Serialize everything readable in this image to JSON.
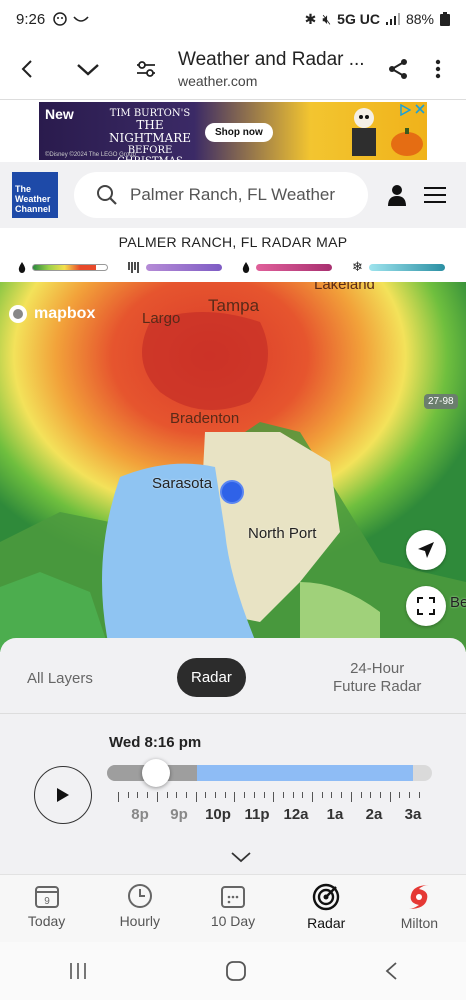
{
  "status_bar": {
    "time": "9:26",
    "network": "5G UC",
    "battery": "88%"
  },
  "browser": {
    "title": "Weather and Radar ...",
    "url": "weather.com"
  },
  "ad": {
    "badge": "New",
    "headline_line1": "TIM BURTON'S",
    "headline_line2": "THE NIGHTMARE",
    "headline_line3": "BEFORE CHRISTMAS",
    "button": "Shop now",
    "copyright": "©Disney  ©2024 The LEGO Group"
  },
  "site": {
    "logo_line1": "The",
    "logo_line2": "Weather",
    "logo_line3": "Channel",
    "search_placeholder": "Palmer Ranch, FL Weather"
  },
  "radar": {
    "title": "PALMER RANCH, FL RADAR MAP",
    "legend": [
      {
        "icon": "rain-drop-icon",
        "colors": [
          "#2b8a3e",
          "#9bd14a",
          "#f4e04d",
          "#e8492a",
          "#ffffff"
        ]
      },
      {
        "icon": "sleet-icon",
        "colors": [
          "#b58bd6",
          "#7e5cc4"
        ]
      },
      {
        "icon": "freezing-rain-drop-icon",
        "colors": [
          "#e0609a",
          "#a83070"
        ]
      },
      {
        "icon": "snowflake-icon",
        "colors": [
          "#9ee4ee",
          "#2b8fa3"
        ]
      }
    ]
  },
  "map": {
    "attribution": "mapbox",
    "places": {
      "lakeland": "Lakeland",
      "largo": "Largo",
      "tampa": "Tampa",
      "bradenton": "Bradenton",
      "sarasota": "Sarasota",
      "north_port": "North Port",
      "edge": "Be"
    },
    "shield": "27-98"
  },
  "tabs": {
    "all_layers": "All Layers",
    "radar": "Radar",
    "future_line1": "24-Hour",
    "future_line2": "Future Radar"
  },
  "timeline": {
    "current": "Wed 8:16 pm",
    "hours": [
      "8p",
      "9p",
      "10p",
      "11p",
      "12a",
      "1a",
      "2a",
      "3a"
    ],
    "progress": 0.15
  },
  "bottom_nav": [
    {
      "label": "Today",
      "icon": "calendar-icon"
    },
    {
      "label": "Hourly",
      "icon": "clock-icon"
    },
    {
      "label": "10 Day",
      "icon": "calendar-grid-icon"
    },
    {
      "label": "Radar",
      "icon": "radar-icon"
    },
    {
      "label": "Milton",
      "icon": "hurricane-icon"
    }
  ],
  "today_day": "9",
  "colors": {
    "radar_blue": "#2f62e8",
    "brand_blue": "#1e4aa8",
    "hurricane_red": "#e53935"
  }
}
